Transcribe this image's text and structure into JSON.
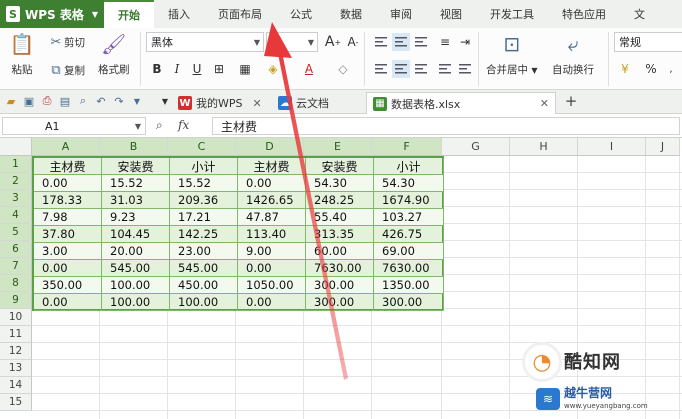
{
  "app": {
    "brand": "WPS 表格",
    "logo_letter": "S"
  },
  "menu_tabs": [
    "开始",
    "插入",
    "页面布局",
    "公式",
    "数据",
    "审阅",
    "视图",
    "开发工具",
    "特色应用",
    "文"
  ],
  "ribbon": {
    "paste": "粘贴",
    "cut": "剪切",
    "copy": "复制",
    "format_painter": "格式刷",
    "font_name": "黑体",
    "font_size": "",
    "merge_center": "合并居中",
    "wrap_text": "自动换行",
    "number_format": "常规",
    "percent": "%",
    "bold": "B",
    "italic": "I",
    "underline": "U",
    "grow_font": "A",
    "shrink_font": "A",
    "font_color_letter": "A"
  },
  "doc_tabs": [
    {
      "label": "我的WPS",
      "icon_letter": "W"
    },
    {
      "label": "云文档",
      "icon_letter": ""
    },
    {
      "label": "数据表格.xlsx",
      "icon_letter": ""
    }
  ],
  "formula_bar": {
    "cell_ref": "A1",
    "fx": "fx",
    "content": "主材费"
  },
  "sheet": {
    "columns": [
      "A",
      "B",
      "C",
      "D",
      "E",
      "F",
      "G",
      "H",
      "I",
      "J"
    ],
    "rows": [
      "1",
      "2",
      "3",
      "4",
      "5",
      "6",
      "7",
      "8",
      "9",
      "10",
      "11",
      "12",
      "13",
      "14",
      "15"
    ],
    "headers": [
      "主材费",
      "安装费",
      "小计",
      "主材费",
      "安装费",
      "小计"
    ],
    "data": [
      [
        "0.00",
        "15.52",
        "15.52",
        "0.00",
        "54.30",
        "54.30"
      ],
      [
        "178.33",
        "31.03",
        "209.36",
        "1426.65",
        "248.25",
        "1674.90"
      ],
      [
        "7.98",
        "9.23",
        "17.21",
        "47.87",
        "55.40",
        "103.27"
      ],
      [
        "37.80",
        "104.45",
        "142.25",
        "113.40",
        "313.35",
        "426.75"
      ],
      [
        "3.00",
        "20.00",
        "23.00",
        "9.00",
        "60.00",
        "69.00"
      ],
      [
        "0.00",
        "545.00",
        "545.00",
        "0.00",
        "7630.00",
        "7630.00"
      ],
      [
        "350.00",
        "100.00",
        "450.00",
        "1050.00",
        "300.00",
        "1350.00"
      ],
      [
        "0.00",
        "100.00",
        "100.00",
        "0.00",
        "300.00",
        "300.00"
      ]
    ]
  },
  "watermark": {
    "title": "酷知网",
    "subtitle": "越牛营网",
    "url": "www.yueyangbang.com"
  },
  "colors": {
    "accent": "#4a8a3a",
    "table_fill": "#e4f2dc",
    "table_border": "#5aa048",
    "arrow": "#e8393a"
  }
}
